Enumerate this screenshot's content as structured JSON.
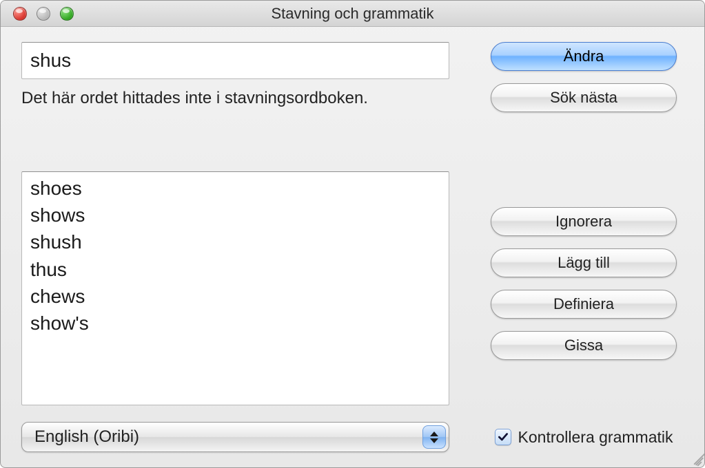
{
  "window": {
    "title": "Stavning och grammatik"
  },
  "word_field": {
    "value": "shus"
  },
  "status": "Det här ordet hittades inte i stavningsordboken.",
  "suggestions": [
    "shoes",
    "shows",
    "shush",
    "thus",
    "chews",
    "show's"
  ],
  "buttons": {
    "change": "Ändra",
    "find_next": "Sök nästa",
    "ignore": "Ignorera",
    "add": "Lägg till",
    "define": "Definiera",
    "guess": "Gissa"
  },
  "language": {
    "selected": "English (Oribi)"
  },
  "grammar_checkbox": {
    "label": "Kontrollera grammatik",
    "checked": true
  }
}
